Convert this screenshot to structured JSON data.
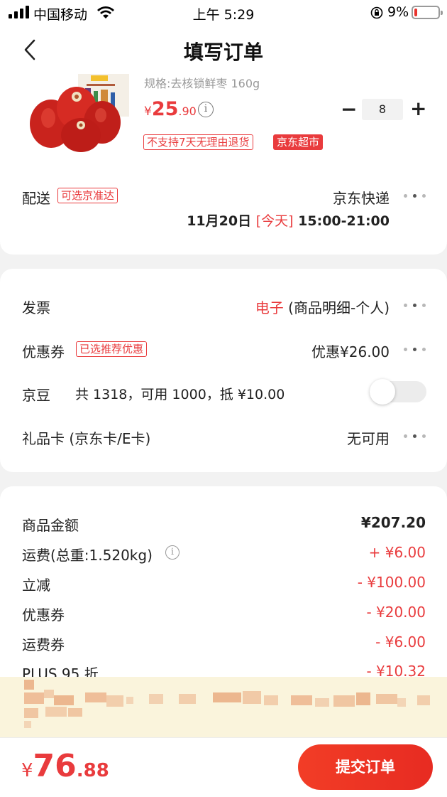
{
  "status_bar": {
    "carrier": "中国移动",
    "time": "上午 5:29",
    "battery": "9%"
  },
  "header": {
    "title": "填写订单",
    "back_icon": "chevron-left-icon"
  },
  "product": {
    "spec": "规格:去核锁鲜枣 160g",
    "price_currency": "¥",
    "price_int": "25",
    "price_dec": ".90",
    "quantity": "8",
    "minus_label": "−",
    "plus_label": "+",
    "tag_no_return": "不支持7天无理由退货",
    "tag_store": "京东超市"
  },
  "delivery": {
    "label": "配送",
    "badge": "可选京准达",
    "carrier": "京东快递",
    "date": "11月20日",
    "today": "[今天]",
    "window": "15:00-21:00"
  },
  "invoice": {
    "label": "发票",
    "type": "电子",
    "detail": " (商品明细-个人)"
  },
  "coupon": {
    "label": "优惠券",
    "badge": "已选推荐优惠",
    "value": "优惠¥26.00"
  },
  "jingdou": {
    "label": "京豆",
    "detail": "共 1318，可用 1000，抵 ¥10.00",
    "enabled": false
  },
  "giftcard": {
    "label": "礼品卡 (京东卡/E卡)",
    "value": "无可用"
  },
  "summary": [
    {
      "label": "商品金额",
      "value": "¥207.20",
      "highlight": false
    },
    {
      "label": "运费(总重:1.520kg)",
      "value": "+ ¥6.00",
      "highlight": true
    },
    {
      "label": "立减",
      "value": "- ¥100.00",
      "highlight": true
    },
    {
      "label": "优惠券",
      "value": "- ¥20.00",
      "highlight": true
    },
    {
      "label": "运费券",
      "value": "- ¥6.00",
      "highlight": true
    },
    {
      "label": "PLUS 95 折",
      "value": "- ¥10.32",
      "highlight": true
    }
  ],
  "bottom": {
    "total_currency": "¥",
    "total_int": "76",
    "total_dec": ".88",
    "submit_label": "提交订单"
  },
  "colors": {
    "accent": "#e93b3d",
    "background": "#f2f2f2"
  }
}
